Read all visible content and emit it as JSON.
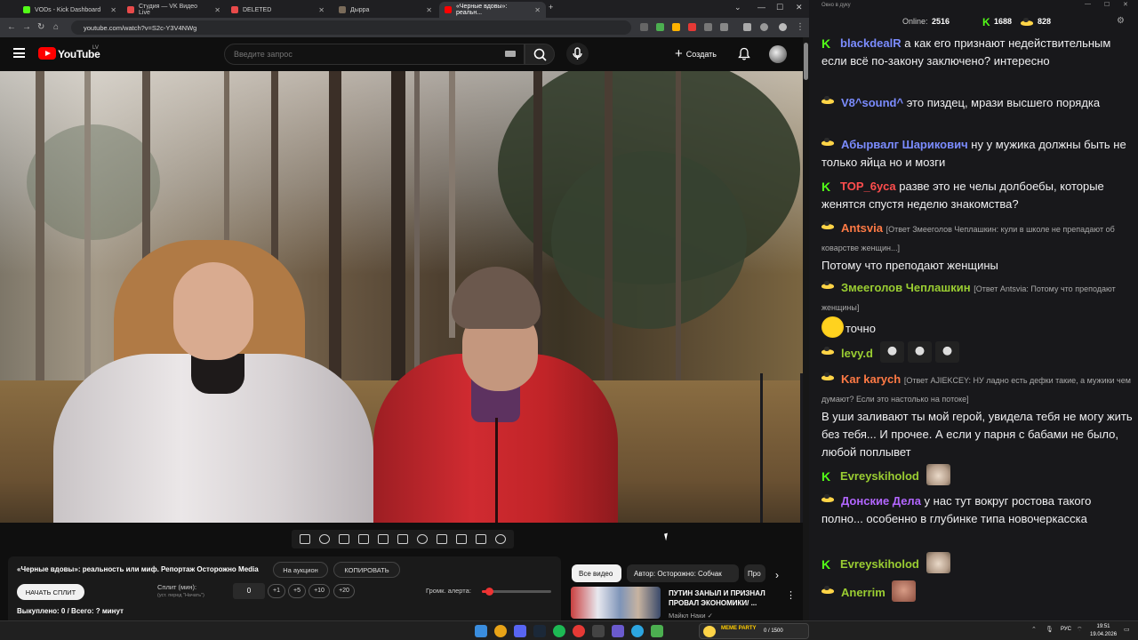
{
  "browser": {
    "tabs": [
      {
        "title": "VODs - Kick Dashboard",
        "color": "#53fc18"
      },
      {
        "title": "Студия — VK Видео Live",
        "color": "#e84a4a"
      },
      {
        "title": "DELETED",
        "color": "#e84a4a"
      },
      {
        "title": "Дырра",
        "color": "#7a6b5a"
      },
      {
        "title": "«Черные вдовы»: реальн...",
        "color": "#ff0000"
      }
    ],
    "url": "youtube.com/watch?v=S2c-Y3V4NWg"
  },
  "youtube": {
    "logo_text": "YouTube",
    "region": "LV",
    "search_placeholder": "Введите запрос",
    "create_label": "Создать"
  },
  "auction": {
    "title": "«Черные вдовы»: реальность или миф. Репортаж Осторожно Media",
    "auction_button": "На аукцион",
    "copy_button": "КОПИРОВАТЬ",
    "start_split": "НАЧАТЬ СПЛИТ",
    "split_label": "Сплит (мин):",
    "split_sub": "(уст. перед \"Начать\")",
    "split_value": "0",
    "increments": [
      "+1",
      "+5",
      "+10",
      "+20"
    ],
    "volume_label": "Громк. алерта:",
    "volume_level": 0.1,
    "bought": "Выкуплено: 0 / Всего: ? минут"
  },
  "related": {
    "chips": [
      "Все видео",
      "Автор: Осторожно: Собчак",
      "Про"
    ],
    "video_title": "ПУТИН ЗАНЫЛ И ПРИЗНАЛ ПРОВАЛ ЭКОНОМИКИ/ ...",
    "video_channel": "Майкл Наки ✓"
  },
  "chat": {
    "window_title": "Окно в дуку",
    "online_label": "Online:",
    "online_count": "2516",
    "kick_count": "1688",
    "other_count": "828",
    "messages": [
      {
        "badge": "kick",
        "user": "blackdealR",
        "color": "#7b8cff",
        "text": "а как его признают недействительным если всё по-закону заключено? интересно"
      },
      {
        "badge": "other",
        "user": "V8^sound^",
        "color": "#7b8cff",
        "text": "это пиздец, мрази высшего порядка"
      },
      {
        "badge": "other",
        "user": "Абырвалг Шарикович",
        "color": "#7b8cff",
        "text": "ну у мужика должны быть не только яйца но и мозги"
      },
      {
        "badge": "kick",
        "user": "TOP_6yca",
        "color": "#ff4d4d",
        "text": "разве это не челы долбоебы, которые женятся спустя неделю знакомства?"
      },
      {
        "badge": "other",
        "user": "Antsvia",
        "color": "#ff7a45",
        "reply": "[Ответ Змееголов Чеплашкин: кули в школе не препадают об коварстве женщин...]",
        "text": "Потому что преподают женщины"
      },
      {
        "badge": "other",
        "user": "Змееголов Чеплашкин",
        "color": "#9acd32",
        "reply": "[Ответ Antsvia: Потому что преподают женщины]",
        "text": "точно"
      },
      {
        "badge": "other",
        "user": "levy.d",
        "color": "#9acd32",
        "text": ""
      },
      {
        "badge": "other",
        "user": "Kar karych",
        "color": "#ff7a45",
        "reply": "[Ответ AJIEKCEY: НУ ладно есть дефки такие, а мужики чем думают? Если это настолько на потоке]",
        "text": "В уши заливают ты мой герой, увидела тебя не могу жить без тебя... И прочее. А если у парня с бабами не было, любой поплывет"
      },
      {
        "badge": "kick",
        "user": "Evreyskiholod",
        "color": "#9acd32",
        "text": ""
      },
      {
        "badge": "other",
        "user": "Донские Дела",
        "color": "#b266ff",
        "text": "у нас тут вокруг ростова такого полно... особенно в глубинке типа новочеркасска"
      },
      {
        "badge": "kick",
        "user": "Evreyskiholod",
        "color": "#9acd32",
        "text": ""
      },
      {
        "badge": "other",
        "user": "Anerrim",
        "color": "#9acd32",
        "text": ""
      }
    ]
  },
  "taskbar": {
    "meme_label": "MEME PARTY",
    "meme_count": "0 / 1500",
    "lang": "РУС",
    "time": "19:51",
    "date": "19.04.2026"
  }
}
